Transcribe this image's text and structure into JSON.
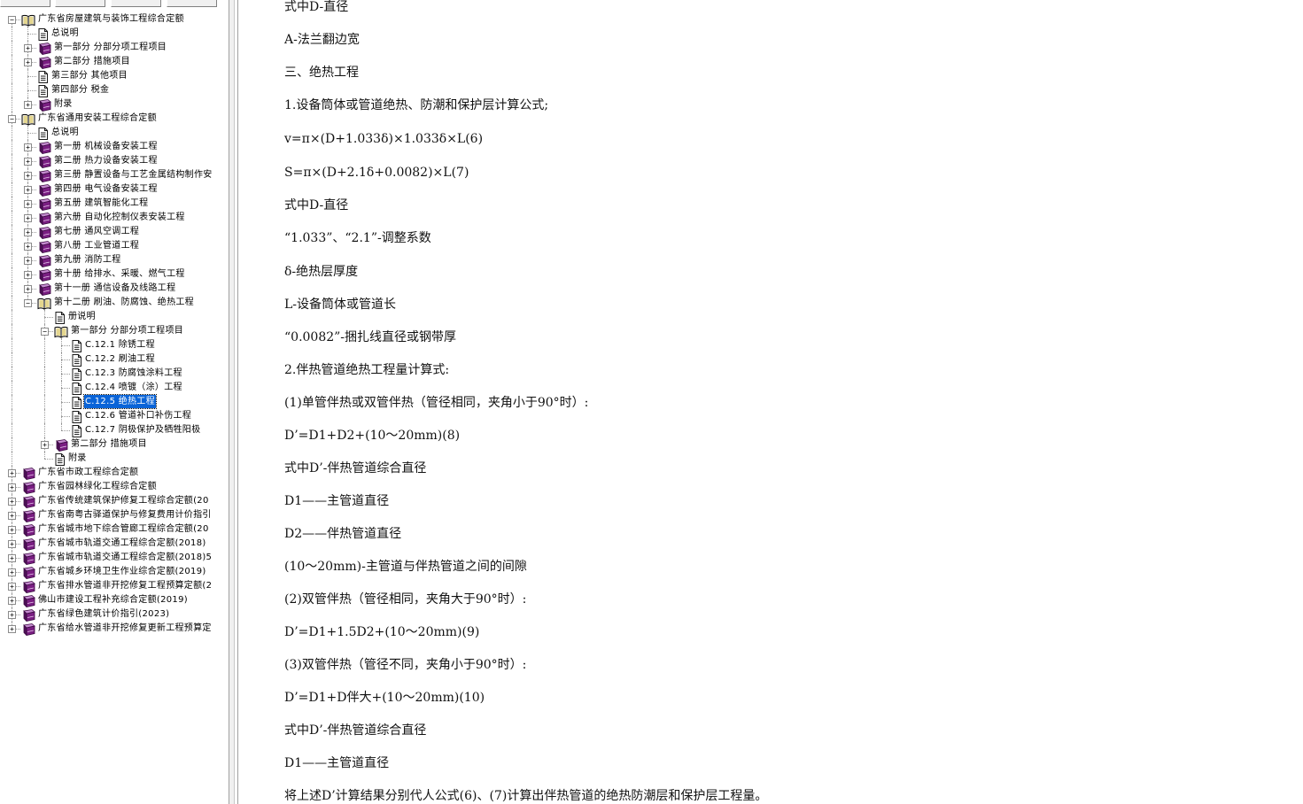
{
  "tree": [
    {
      "level": 0,
      "exp": "-",
      "icon": "book-open",
      "label": "广东省房屋建筑与装饰工程综合定额"
    },
    {
      "level": 1,
      "exp": "",
      "icon": "doc",
      "label": "总说明"
    },
    {
      "level": 1,
      "exp": "+",
      "icon": "book",
      "label": "第一部分  分部分项工程项目"
    },
    {
      "level": 1,
      "exp": "+",
      "icon": "book",
      "label": "第二部分  措施项目"
    },
    {
      "level": 1,
      "exp": "",
      "icon": "doc",
      "label": "第三部分  其他项目"
    },
    {
      "level": 1,
      "exp": "",
      "icon": "doc",
      "label": "第四部分  税金"
    },
    {
      "level": 1,
      "exp": "+",
      "icon": "book",
      "label": "附录"
    },
    {
      "level": 0,
      "exp": "-",
      "icon": "book-open",
      "label": "广东省通用安装工程综合定额"
    },
    {
      "level": 1,
      "exp": "",
      "icon": "doc",
      "label": "总说明"
    },
    {
      "level": 1,
      "exp": "+",
      "icon": "book",
      "label": "第一册  机械设备安装工程"
    },
    {
      "level": 1,
      "exp": "+",
      "icon": "book",
      "label": "第二册  热力设备安装工程"
    },
    {
      "level": 1,
      "exp": "+",
      "icon": "book",
      "label": "第三册  静置设备与工艺金属结构制作安"
    },
    {
      "level": 1,
      "exp": "+",
      "icon": "book",
      "label": "第四册  电气设备安装工程"
    },
    {
      "level": 1,
      "exp": "+",
      "icon": "book",
      "label": "第五册  建筑智能化工程"
    },
    {
      "level": 1,
      "exp": "+",
      "icon": "book",
      "label": "第六册  自动化控制仪表安装工程"
    },
    {
      "level": 1,
      "exp": "+",
      "icon": "book",
      "label": "第七册  通风空调工程"
    },
    {
      "level": 1,
      "exp": "+",
      "icon": "book",
      "label": "第八册  工业管道工程"
    },
    {
      "level": 1,
      "exp": "+",
      "icon": "book",
      "label": "第九册  消防工程"
    },
    {
      "level": 1,
      "exp": "+",
      "icon": "book",
      "label": "第十册  给排水、采暖、燃气工程"
    },
    {
      "level": 1,
      "exp": "+",
      "icon": "book",
      "label": "第十一册  通信设备及线路工程"
    },
    {
      "level": 1,
      "exp": "-",
      "icon": "book-open",
      "label": "第十二册  刷油、防腐蚀、绝热工程"
    },
    {
      "level": 2,
      "exp": "",
      "icon": "doc",
      "label": "册说明"
    },
    {
      "level": 2,
      "exp": "-",
      "icon": "book-open",
      "label": "第一部分  分部分项工程项目"
    },
    {
      "level": 3,
      "exp": "",
      "icon": "doc",
      "label": "C.12.1  除锈工程"
    },
    {
      "level": 3,
      "exp": "",
      "icon": "doc",
      "label": "C.12.2  刷油工程"
    },
    {
      "level": 3,
      "exp": "",
      "icon": "doc",
      "label": "C.12.3  防腐蚀涂料工程"
    },
    {
      "level": 3,
      "exp": "",
      "icon": "doc",
      "label": "C.12.4  喷镀（涂）工程"
    },
    {
      "level": 3,
      "exp": "",
      "icon": "doc",
      "label": "C.12.5  绝热工程",
      "selected": true
    },
    {
      "level": 3,
      "exp": "",
      "icon": "doc",
      "label": "C.12.6  管道补口补伤工程"
    },
    {
      "level": 3,
      "exp": "",
      "icon": "doc",
      "label": "C.12.7  阴极保护及牺牲阳极"
    },
    {
      "level": 2,
      "exp": "+",
      "icon": "book",
      "label": "第二部分  措施项目"
    },
    {
      "level": 2,
      "exp": "",
      "icon": "doc",
      "label": "附录"
    },
    {
      "level": 0,
      "exp": "+",
      "icon": "book",
      "label": "广东省市政工程综合定额"
    },
    {
      "level": 0,
      "exp": "+",
      "icon": "book",
      "label": "广东省园林绿化工程综合定额"
    },
    {
      "level": 0,
      "exp": "+",
      "icon": "book",
      "label": "广东省传统建筑保护修复工程综合定额(20"
    },
    {
      "level": 0,
      "exp": "+",
      "icon": "book",
      "label": "广东省南粤古驿道保护与修复费用计价指引"
    },
    {
      "level": 0,
      "exp": "+",
      "icon": "book",
      "label": "广东省城市地下综合管廊工程综合定额(20"
    },
    {
      "level": 0,
      "exp": "+",
      "icon": "book",
      "label": "广东省城市轨道交通工程综合定额(2018)"
    },
    {
      "level": 0,
      "exp": "+",
      "icon": "book",
      "label": "广东省城市轨道交通工程综合定额(2018)5"
    },
    {
      "level": 0,
      "exp": "+",
      "icon": "book",
      "label": "广东省城乡环境卫生作业综合定额(2019)"
    },
    {
      "level": 0,
      "exp": "+",
      "icon": "book",
      "label": "广东省排水管道非开挖修复工程预算定额(2"
    },
    {
      "level": 0,
      "exp": "+",
      "icon": "book",
      "label": "佛山市建设工程补充综合定额(2019)"
    },
    {
      "level": 0,
      "exp": "+",
      "icon": "book",
      "label": "广东省绿色建筑计价指引(2023)"
    },
    {
      "level": 0,
      "exp": "+",
      "icon": "book",
      "label": "广东省给水管道非开挖修复更新工程预算定"
    }
  ],
  "content": [
    "式中D-直径",
    "A-法兰翻边宽",
    "三、绝热工程",
    "1.设备筒体或管道绝热、防潮和保护层计算公式;",
    "v=π×(D+1.033δ)×1.033δ×L(6)",
    "S=π×(D+2.1δ+0.0082)×L(7)",
    "式中D-直径",
    "“1.033”、“2.1”-调整系数",
    "δ-绝热层厚度",
    "L-设备筒体或管道长",
    "“0.0082”-捆扎线直径或钢带厚",
    "2.伴热管道绝热工程量计算式:",
    "(1)单管伴热或双管伴热（管径相同，夹角小于90°时）:",
    "D’=D1+D2+(10～20mm)(8)",
    "式中D’-伴热管道综合直径",
    "D1——主管道直径",
    "D2——伴热管道直径",
    "(10～20mm)-主管道与伴热管道之间的间隙",
    "(2)双管伴热（管径相同，夹角大于90°时）:",
    "D’=D1+1.5D2+(10～20mm)(9)",
    "(3)双管伴热（管径不同，夹角小于90°时）:",
    "D’=D1+D伴大+(10～20mm)(10)",
    "式中D’-伴热管道综合直径",
    "D1——主管道直径",
    "将上述D’计算结果分别代人公式(6)、(7)计算出伴热管道的绝热防潮层和保护层工程量。"
  ],
  "icons": {
    "book": "closed-book-icon",
    "book-open": "open-book-icon",
    "doc": "document-icon"
  },
  "colors": {
    "book": "#7a1e82",
    "selection": "#0a64d8"
  }
}
